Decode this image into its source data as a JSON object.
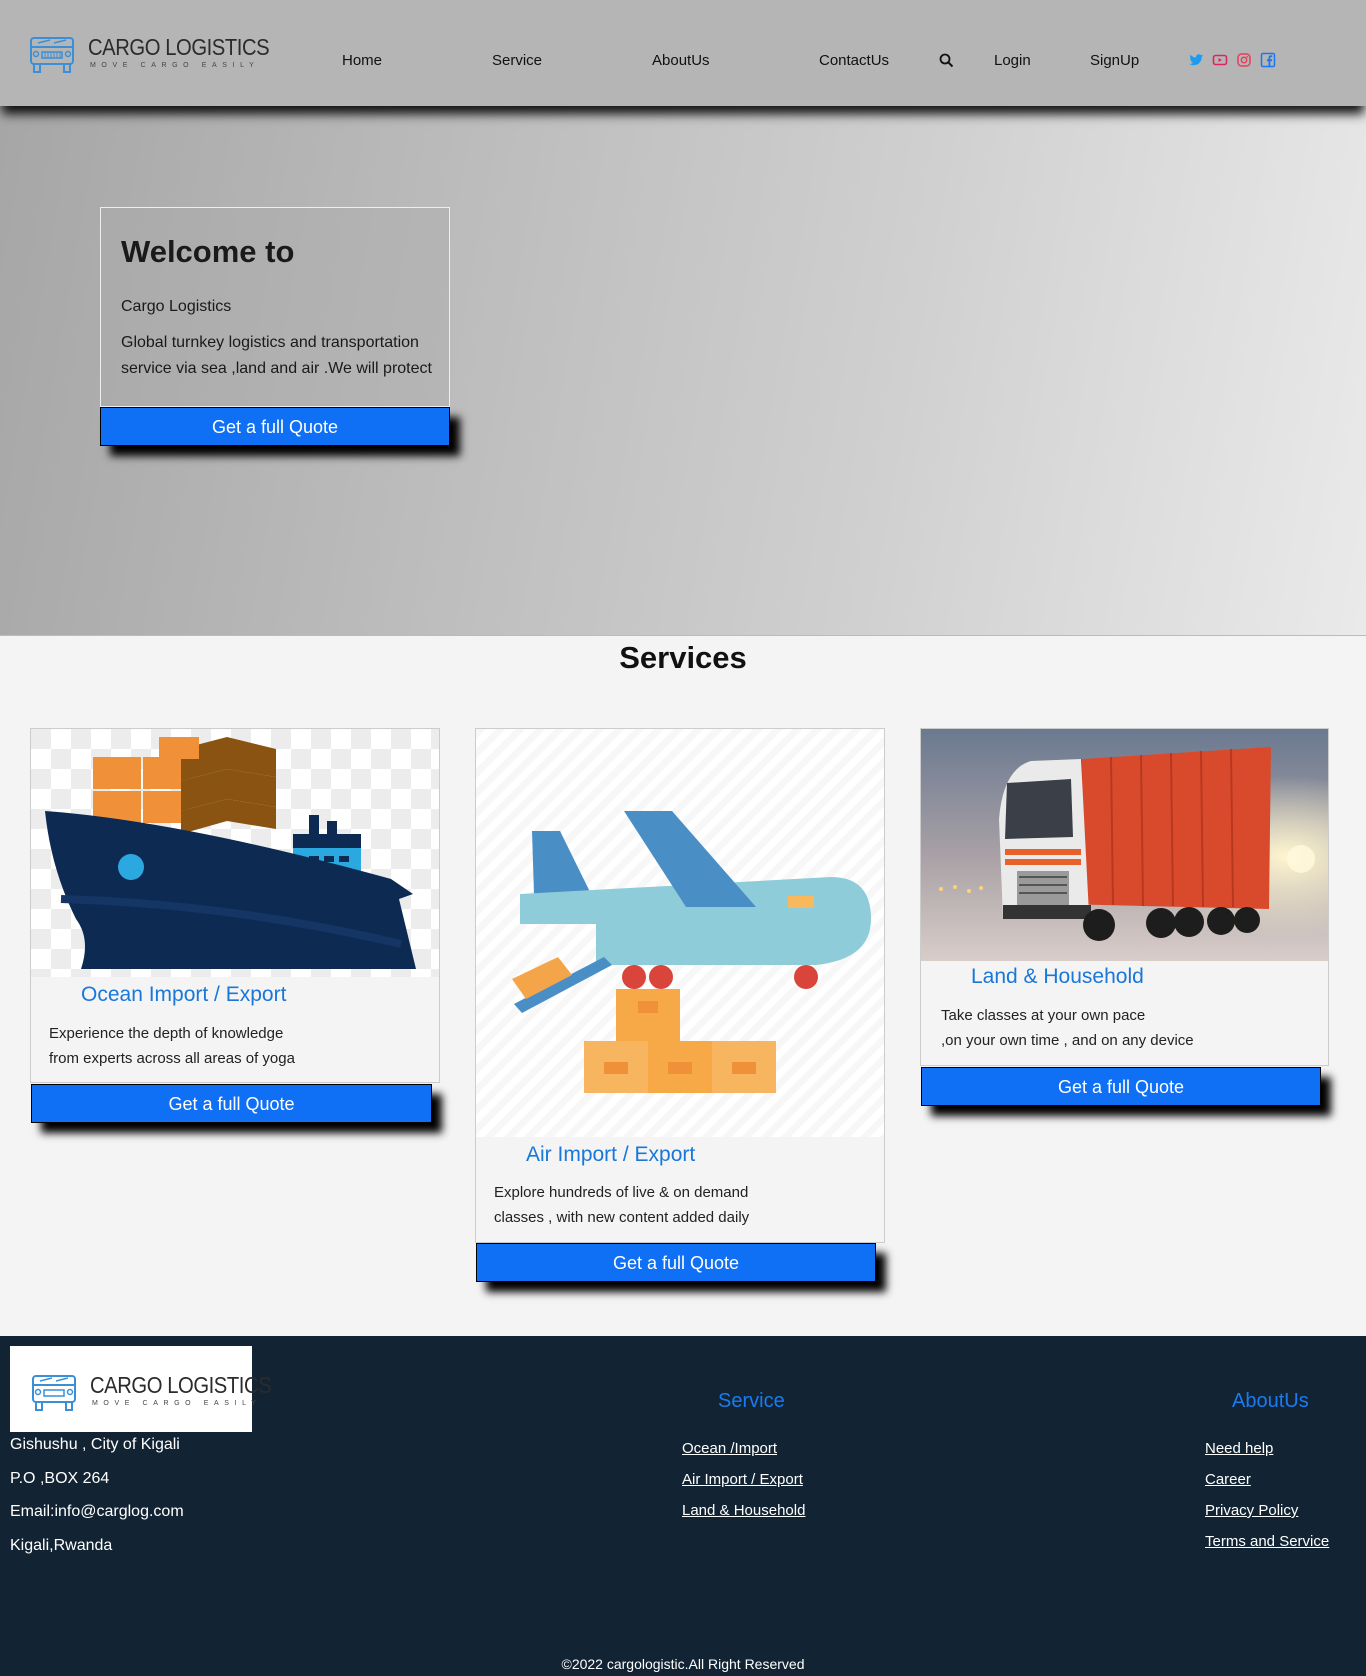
{
  "header": {
    "logo": {
      "title": "CARGO LOGISTICS",
      "tagline": "MOVE CARGO EASILY"
    },
    "nav": [
      {
        "label": "Home"
      },
      {
        "label": "Service"
      },
      {
        "label": "AboutUs"
      },
      {
        "label": "ContactUs"
      },
      {
        "label": "Login"
      },
      {
        "label": "SignUp"
      }
    ],
    "icons": [
      "search-icon",
      "twitter-icon",
      "youtube-icon",
      "instagram-icon",
      "facebook-icon"
    ],
    "social_colors": {
      "twitter": "#1d9bf0",
      "youtube": "#e0245e",
      "instagram": "#e4405f",
      "facebook": "#1877f2"
    }
  },
  "hero": {
    "title": "Welcome to",
    "subtitle": "Cargo Logistics",
    "description": "Global turnkey logistics and transportation service via sea ,land and air .We will protect",
    "button": "Get a full Quote"
  },
  "services": {
    "title": "Services",
    "cards": [
      {
        "title": "Ocean Import / Export",
        "line1": "Experience the depth of knowledge",
        "line2": "from experts across all areas of yoga",
        "button": "Get a full Quote",
        "image_icon": "cargo-ship-icon"
      },
      {
        "title": "Air Import / Export",
        "line1": "Explore hundreds of live & on demand",
        "line2": "classes , with new content added daily",
        "button": "Get a full Quote",
        "image_icon": "cargo-plane-icon"
      },
      {
        "title": "Land & Household",
        "line1": "Take classes at your own pace",
        "line2": ",on your own time , and on any device",
        "button": "Get a full Quote",
        "image_icon": "cargo-truck-photo"
      }
    ]
  },
  "footer": {
    "logo": {
      "title": "CARGO LOGISTICS",
      "tagline": "MOVE CARGO EASILY"
    },
    "address": [
      "Gishushu , City of Kigali",
      "P.O ,BOX 264",
      "Email:info@carglog.com",
      "Kigali,Rwanda"
    ],
    "service": {
      "heading": "Service",
      "links": [
        "Ocean /Import",
        "Air Import / Export",
        "Land & Household"
      ]
    },
    "about": {
      "heading": "AboutUs",
      "links": [
        "Need help",
        "Career",
        "Privacy Policy",
        "Terms and Service"
      ]
    },
    "copyright": "©2022 cargologistic.All Right Reserved"
  },
  "colors": {
    "accent": "#0f6ff5",
    "link_blue": "#1877d9",
    "header_bg": "#b5b5b5",
    "footer_bg": "#122433",
    "page_bg": "#f4f4f4"
  }
}
